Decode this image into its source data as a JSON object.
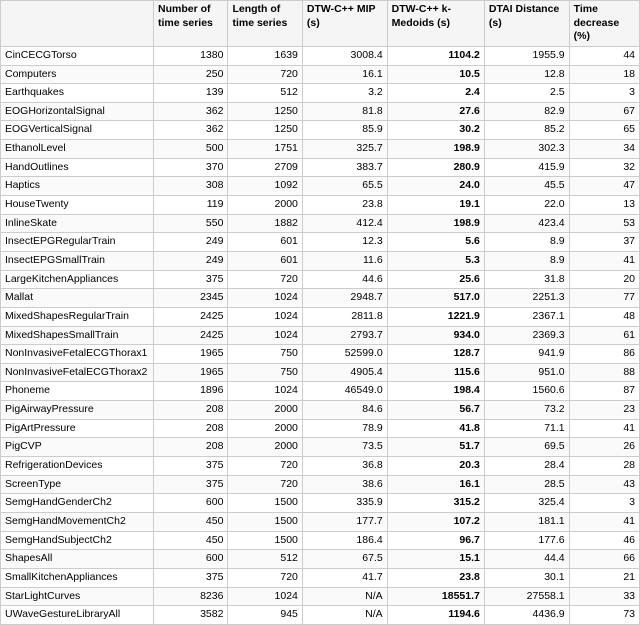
{
  "table": {
    "headers": [
      "",
      "Number of time series",
      "Length of time series",
      "DTW-C++ MIP (s)",
      "DTW-C++ k-Medoids (s)",
      "DTAI Distance (s)",
      "Time decrease (%)"
    ],
    "rows": [
      [
        "CinCECGTorso",
        "1380",
        "1639",
        "3008.4",
        "1104.2",
        "1955.9",
        "44"
      ],
      [
        "Computers",
        "250",
        "720",
        "16.1",
        "10.5",
        "12.8",
        "18"
      ],
      [
        "Earthquakes",
        "139",
        "512",
        "3.2",
        "2.4",
        "2.5",
        "3"
      ],
      [
        "EOGHorizontalSignal",
        "362",
        "1250",
        "81.8",
        "27.6",
        "82.9",
        "67"
      ],
      [
        "EOGVerticalSignal",
        "362",
        "1250",
        "85.9",
        "30.2",
        "85.2",
        "65"
      ],
      [
        "EthanolLevel",
        "500",
        "1751",
        "325.7",
        "198.9",
        "302.3",
        "34"
      ],
      [
        "HandOutlines",
        "370",
        "2709",
        "383.7",
        "280.9",
        "415.9",
        "32"
      ],
      [
        "Haptics",
        "308",
        "1092",
        "65.5",
        "24.0",
        "45.5",
        "47"
      ],
      [
        "HouseTwenty",
        "119",
        "2000",
        "23.8",
        "19.1",
        "22.0",
        "13"
      ],
      [
        "InlineSkate",
        "550",
        "1882",
        "412.4",
        "198.9",
        "423.4",
        "53"
      ],
      [
        "InsectEPGRegularTrain",
        "249",
        "601",
        "12.3",
        "5.6",
        "8.9",
        "37"
      ],
      [
        "InsectEPGSmallTrain",
        "249",
        "601",
        "11.6",
        "5.3",
        "8.9",
        "41"
      ],
      [
        "LargeKitchenAppliances",
        "375",
        "720",
        "44.6",
        "25.6",
        "31.8",
        "20"
      ],
      [
        "Mallat",
        "2345",
        "1024",
        "2948.7",
        "517.0",
        "2251.3",
        "77"
      ],
      [
        "MixedShapesRegularTrain",
        "2425",
        "1024",
        "2811.8",
        "1221.9",
        "2367.1",
        "48"
      ],
      [
        "MixedShapesSmallTrain",
        "2425",
        "1024",
        "2793.7",
        "934.0",
        "2369.3",
        "61"
      ],
      [
        "NonInvasiveFetalECGThorax1",
        "1965",
        "750",
        "52599.0",
        "128.7",
        "941.9",
        "86"
      ],
      [
        "NonInvasiveFetalECGThorax2",
        "1965",
        "750",
        "4905.4",
        "115.6",
        "951.0",
        "88"
      ],
      [
        "Phoneme",
        "1896",
        "1024",
        "46549.0",
        "198.4",
        "1560.6",
        "87"
      ],
      [
        "PigAirwayPressure",
        "208",
        "2000",
        "84.6",
        "56.7",
        "73.2",
        "23"
      ],
      [
        "PigArtPressure",
        "208",
        "2000",
        "78.9",
        "41.8",
        "71.1",
        "41"
      ],
      [
        "PigCVP",
        "208",
        "2000",
        "73.5",
        "51.7",
        "69.5",
        "26"
      ],
      [
        "RefrigerationDevices",
        "375",
        "720",
        "36.8",
        "20.3",
        "28.4",
        "28"
      ],
      [
        "ScreenType",
        "375",
        "720",
        "38.6",
        "16.1",
        "28.5",
        "43"
      ],
      [
        "SemgHandGenderCh2",
        "600",
        "1500",
        "335.9",
        "315.2",
        "325.4",
        "3"
      ],
      [
        "SemgHandMovementCh2",
        "450",
        "1500",
        "177.7",
        "107.2",
        "181.1",
        "41"
      ],
      [
        "SemgHandSubjectCh2",
        "450",
        "1500",
        "186.4",
        "96.7",
        "177.6",
        "46"
      ],
      [
        "ShapesAll",
        "600",
        "512",
        "67.5",
        "15.1",
        "44.4",
        "66"
      ],
      [
        "SmallKitchenAppliances",
        "375",
        "720",
        "41.7",
        "23.8",
        "30.1",
        "21"
      ],
      [
        "StarLightCurves",
        "8236",
        "1024",
        "N/A",
        "18551.7",
        "27558.1",
        "33"
      ],
      [
        "UWaveGestureLibraryAll",
        "3582",
        "945",
        "N/A",
        "1194.6",
        "4436.9",
        "73"
      ]
    ],
    "bold_col": 3
  }
}
